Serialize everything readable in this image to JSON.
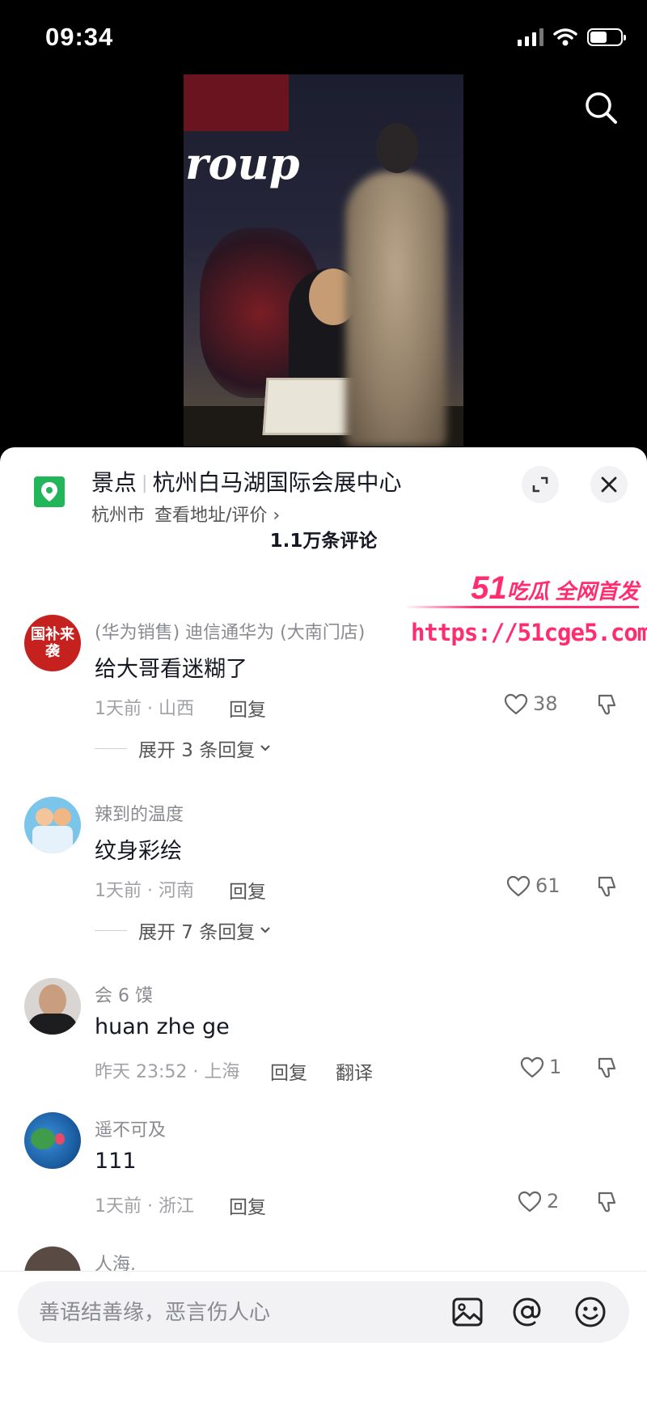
{
  "status_bar": {
    "time": "09:34"
  },
  "video": {
    "banner_text": "roup"
  },
  "location": {
    "category": "景点",
    "name": "杭州白马湖国际会展中心",
    "city": "杭州市",
    "view_link": "查看地址/评价 ›"
  },
  "comments_header": {
    "count": "1.1万条评论"
  },
  "comments": [
    {
      "user": "(华为销售) 迪信通华为 (大南门店)",
      "avatar_text": "国补来袭",
      "text": "给大哥看迷糊了",
      "meta": "1天前 · 山西",
      "reply": "回复",
      "likes": "38",
      "expand": "展开 3 条回复"
    },
    {
      "user": "辣到的温度",
      "text": "纹身彩绘",
      "meta": "1天前 · 河南",
      "reply": "回复",
      "likes": "61",
      "expand": "展开 7 条回复"
    },
    {
      "user": "会 6 馍",
      "text": "huan zhe ge",
      "meta": "昨天 23:52 · 上海",
      "reply": "回复",
      "translate": "翻译",
      "likes": "1"
    },
    {
      "user": "遥不可及",
      "text": "111",
      "meta": "1天前 · 浙江",
      "reply": "回复",
      "likes": "2"
    },
    {
      "user": "人海."
    }
  ],
  "input": {
    "placeholder": "善语结善缘，恶言伤人心"
  },
  "watermark": {
    "brand_num": "51",
    "brand_text": "吃瓜 全网首发",
    "url": "https://51cge5.com"
  },
  "colors": {
    "location_pin": "#22b55a",
    "watermark": "#ff2d6f"
  }
}
